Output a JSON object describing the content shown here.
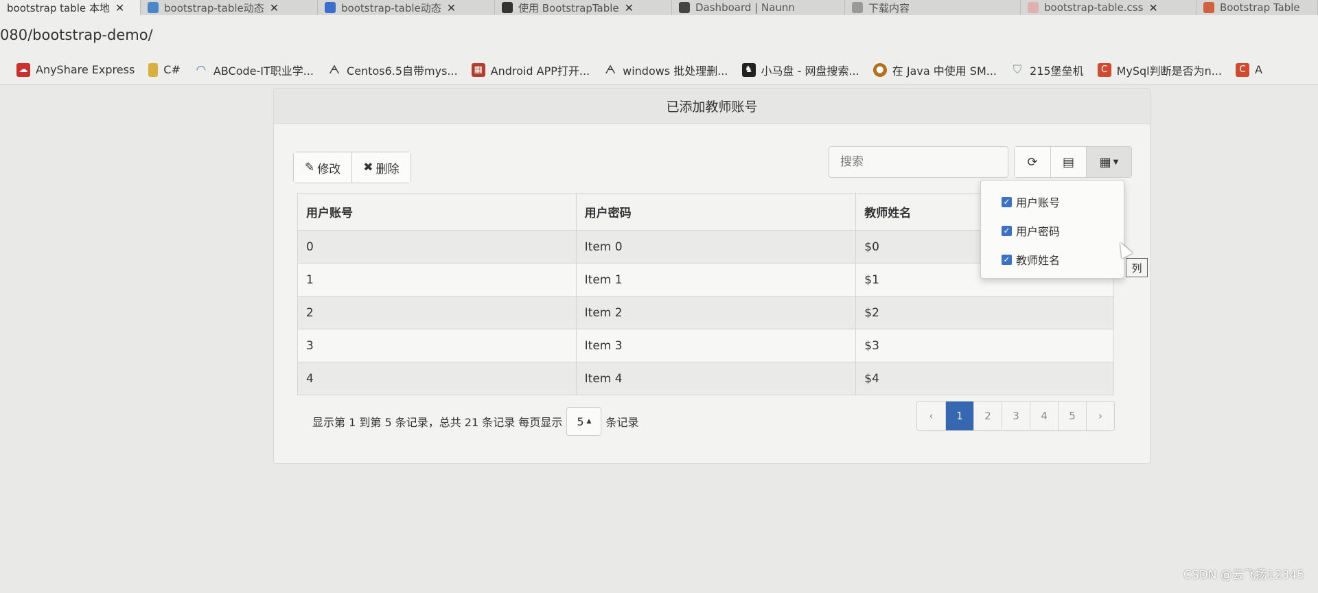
{
  "browser": {
    "tabs": [
      {
        "title": "bootstrap table 本地",
        "color": "#e9e9e7"
      },
      {
        "title": "bootstrap-table动态",
        "color": "#4a86c8"
      },
      {
        "title": "bootstrap-table动态",
        "color": "#3a6fd0"
      },
      {
        "title": "使用 BootstrapTable",
        "color": "#333333"
      },
      {
        "title": "Dashboard | Naunn",
        "color": "#444444"
      },
      {
        "title": "下载内容",
        "color": "#777777"
      },
      {
        "title": "bootstrap-table.css",
        "color": "#e0b0b0"
      },
      {
        "title": "Bootstrap Table",
        "color": "#d06040"
      }
    ],
    "url": "080/bootstrap-demo/",
    "bookmarks": [
      {
        "label": "AnyShare Express",
        "color": "#c8322f"
      },
      {
        "label": "C#",
        "color": "#d8b040"
      },
      {
        "label": "ABCode-IT职业学...",
        "color": "#5a7fa8"
      },
      {
        "label": "Centos6.5自带mys...",
        "color": "#333333"
      },
      {
        "label": "Android APP打开...",
        "color": "#b04030"
      },
      {
        "label": "windows 批处理删...",
        "color": "#333333"
      },
      {
        "label": "小马盘 - 网盘搜索...",
        "color": "#222222"
      },
      {
        "label": "在 Java 中使用 SM...",
        "color": "#b07020"
      },
      {
        "label": "215堡垒机",
        "color": "#8a94a8"
      },
      {
        "label": "MySql判断是否为n...",
        "color": "#d04a30"
      },
      {
        "label": "A",
        "color": "#d04a30"
      }
    ]
  },
  "panel": {
    "title": "已添加教师账号"
  },
  "toolbar": {
    "edit_label": "修改",
    "delete_label": "删除",
    "search_placeholder": "搜索",
    "refresh_icon": "refresh-icon",
    "toggle_icon": "list-icon",
    "columns_icon": "columns-icon"
  },
  "table": {
    "headers": [
      "用户账号",
      "用户密码",
      "教师姓名"
    ],
    "rows": [
      [
        "0",
        "Item 0",
        "$0"
      ],
      [
        "1",
        "Item 1",
        "$1"
      ],
      [
        "2",
        "Item 2",
        "$2"
      ],
      [
        "3",
        "Item 3",
        "$3"
      ],
      [
        "4",
        "Item 4",
        "$4"
      ]
    ]
  },
  "columns_dropdown": {
    "items": [
      {
        "label": "用户账号",
        "checked": true
      },
      {
        "label": "用户密码",
        "checked": true
      },
      {
        "label": "教师姓名",
        "checked": true
      }
    ],
    "tooltip": "列"
  },
  "pager": {
    "info": "显示第 1 到第 5 条记录，总共 21 条记录 每页显示",
    "page_size": "5",
    "suffix": "条记录",
    "prev": "‹",
    "next": "›",
    "pages": [
      "1",
      "2",
      "3",
      "4",
      "5"
    ],
    "active_page": "1"
  },
  "watermark": "CSDN @云飞扬12345",
  "colors": {
    "accent": "#3568b0",
    "checkbox": "#3b72c4"
  }
}
